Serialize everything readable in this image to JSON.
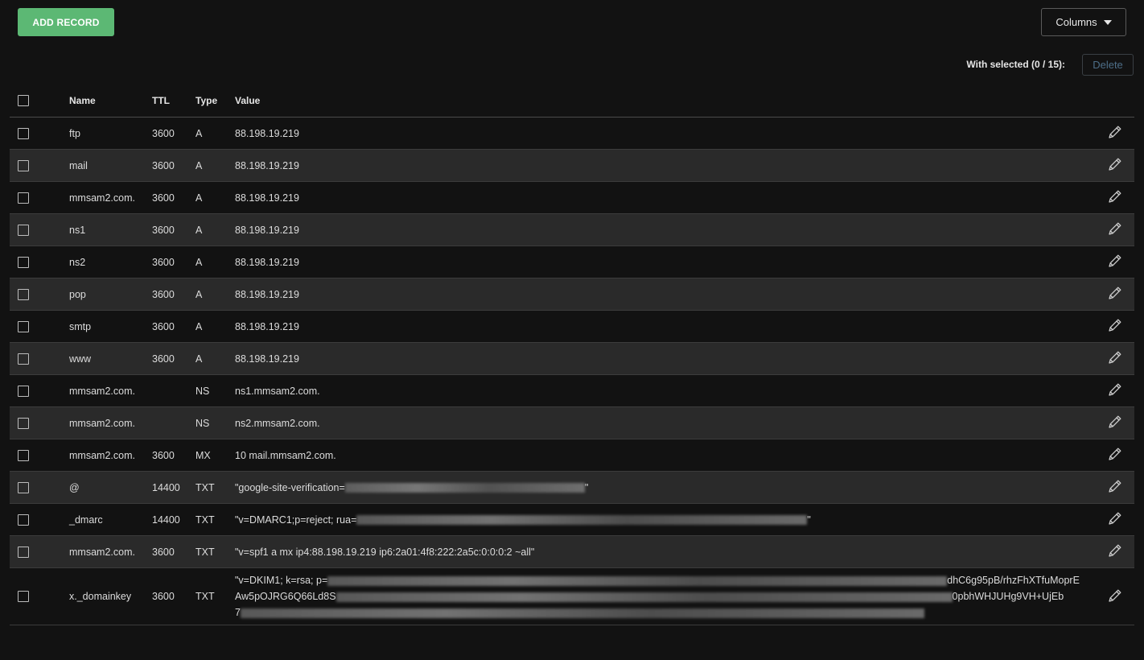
{
  "toolbar": {
    "add_label": "ADD RECORD",
    "columns_label": "Columns",
    "with_selected": "With selected (0 / 15):",
    "delete_label": "Delete"
  },
  "headers": {
    "name": "Name",
    "ttl": "TTL",
    "type": "Type",
    "value": "Value"
  },
  "icons": {
    "edit": "pencil-icon",
    "columns_caret": "caret-down-icon"
  },
  "colors": {
    "accent": "#5cb874",
    "background": "#121212",
    "row_alt": "#2a2a2a"
  },
  "records": [
    {
      "name": "ftp",
      "ttl": "3600",
      "type": "A",
      "value": "88.198.19.219"
    },
    {
      "name": "mail",
      "ttl": "3600",
      "type": "A",
      "value": "88.198.19.219"
    },
    {
      "name": "mmsam2.com.",
      "ttl": "3600",
      "type": "A",
      "value": "88.198.19.219"
    },
    {
      "name": "ns1",
      "ttl": "3600",
      "type": "A",
      "value": "88.198.19.219"
    },
    {
      "name": "ns2",
      "ttl": "3600",
      "type": "A",
      "value": "88.198.19.219"
    },
    {
      "name": "pop",
      "ttl": "3600",
      "type": "A",
      "value": "88.198.19.219"
    },
    {
      "name": "smtp",
      "ttl": "3600",
      "type": "A",
      "value": "88.198.19.219"
    },
    {
      "name": "www",
      "ttl": "3600",
      "type": "A",
      "value": "88.198.19.219"
    },
    {
      "name": "mmsam2.com.",
      "ttl": "",
      "type": "NS",
      "value": "ns1.mmsam2.com."
    },
    {
      "name": "mmsam2.com.",
      "ttl": "",
      "type": "NS",
      "value": "ns2.mmsam2.com."
    },
    {
      "name": "mmsam2.com.",
      "ttl": "3600",
      "type": "MX",
      "value": "10 mail.mmsam2.com."
    },
    {
      "name": "@",
      "ttl": "14400",
      "type": "TXT",
      "value_prefix": "\"google-site-verification=",
      "value_suffix": "\""
    },
    {
      "name": "_dmarc",
      "ttl": "14400",
      "type": "TXT",
      "value_prefix": "\"v=DMARC1;p=reject; rua=",
      "value_suffix": "\""
    },
    {
      "name": "mmsam2.com.",
      "ttl": "3600",
      "type": "TXT",
      "value": "\"v=spf1 a mx ip4:88.198.19.219 ip6:2a01:4f8:222:2a5c:0:0:0:2 ~all\""
    },
    {
      "name": "x._domainkey",
      "ttl": "3600",
      "type": "TXT",
      "line1_prefix": "\"v=DKIM1; k=rsa; p=",
      "line1_suffix": "dhC6g95pB/rhzFhXTfuMoprE",
      "line2_prefix": "Aw5pOJRG6Q66Ld8S",
      "line2_suffix": "0pbhWHJUHg9VH+UjEb",
      "line3_prefix": "7"
    }
  ]
}
